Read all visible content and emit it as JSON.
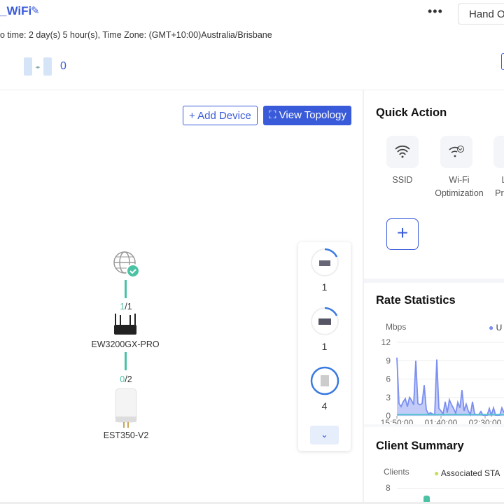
{
  "header": {
    "title": "_WiFi",
    "info": "o time: 2 day(s) 5 hour(s), Time Zone: (GMT+10:00)Australia/Brisbane",
    "more_label": "•••",
    "hand_over_label": "Hand O",
    "bridge_count": "0"
  },
  "topology": {
    "add_device_label": "+ Add Device",
    "view_topology_label": "View Topology",
    "nodes": [
      {
        "name": "EW3200GX-PRO",
        "ports_up": "1",
        "ports_total": "/1"
      },
      {
        "name": "EST350-V2",
        "ports_up": "0",
        "ports_total": "/2"
      }
    ],
    "side_counts": [
      "1",
      "1",
      "4"
    ]
  },
  "quick_action": {
    "title": "Quick Action",
    "items": [
      {
        "label": "SSID",
        "icon": "wifi-icon"
      },
      {
        "label": "Wi-Fi",
        "label2": "Optimization",
        "icon": "wifi-optimization-icon"
      },
      {
        "label": "L",
        "label2": "Prev",
        "icon": "preview-icon"
      }
    ]
  },
  "rate_statistics": {
    "title": "Rate Statistics"
  },
  "client_summary": {
    "title": "Client Summary",
    "ylabel": "Clients",
    "legend": "Associated STA",
    "y_tick": "8"
  },
  "colors": {
    "accent": "#3a5bd9",
    "link": "#4cc2a5",
    "upload": "#7b8ff0",
    "download": "#52c4d0",
    "sta": "#c6e05a"
  },
  "chart_data": {
    "type": "area",
    "title": "Rate Statistics",
    "ylabel": "Mbps",
    "ylim": [
      0,
      12
    ],
    "yticks": [
      "0",
      "3",
      "6",
      "9",
      "12"
    ],
    "xticks": [
      "15:50:00",
      "01:40:00",
      "02:30:00"
    ],
    "grid": true,
    "legend_placement": "top",
    "series": [
      {
        "name": "U",
        "values": [
          9.5,
          2,
          1.5,
          2.3,
          2.8,
          1.5,
          3,
          2.5,
          1.8,
          9,
          2,
          1.8,
          2,
          5,
          1,
          0.3,
          0.5,
          0.3,
          0.2,
          9.2,
          1.2,
          0.8,
          0.3,
          2.3,
          0.5,
          2.6,
          1.8,
          1.2,
          0.4,
          2.2,
          1.3,
          4.2,
          0.8,
          1.9,
          0.8,
          0.2,
          2.3,
          0.3,
          0.2,
          0.2,
          0.7,
          0.1,
          0.1,
          0.1,
          1.2,
          0.1,
          1.3,
          0.1,
          0.1,
          0.1,
          1.3,
          0.5
        ]
      },
      {
        "values": [
          0.2,
          0.2,
          0.2,
          0.2,
          0.2,
          0.2,
          0.2,
          0.2,
          0.2,
          0.2,
          0.2,
          0.2,
          0.2,
          0.2,
          0.2,
          0.2,
          0.2,
          0.2,
          0.2,
          0.2,
          0.2,
          0.2,
          0.2,
          0.2,
          0.2,
          0.2,
          0.2,
          0.2,
          0.2,
          0.2,
          0.2,
          0.2,
          0.2,
          0.2,
          0.2,
          0.2,
          0.2,
          0.2,
          0.2,
          0.2,
          0.2,
          0.2,
          0.2,
          0.2,
          0.2,
          0.2,
          0.2,
          0.2,
          0.2,
          0.2,
          0.2,
          0.2
        ]
      }
    ]
  }
}
